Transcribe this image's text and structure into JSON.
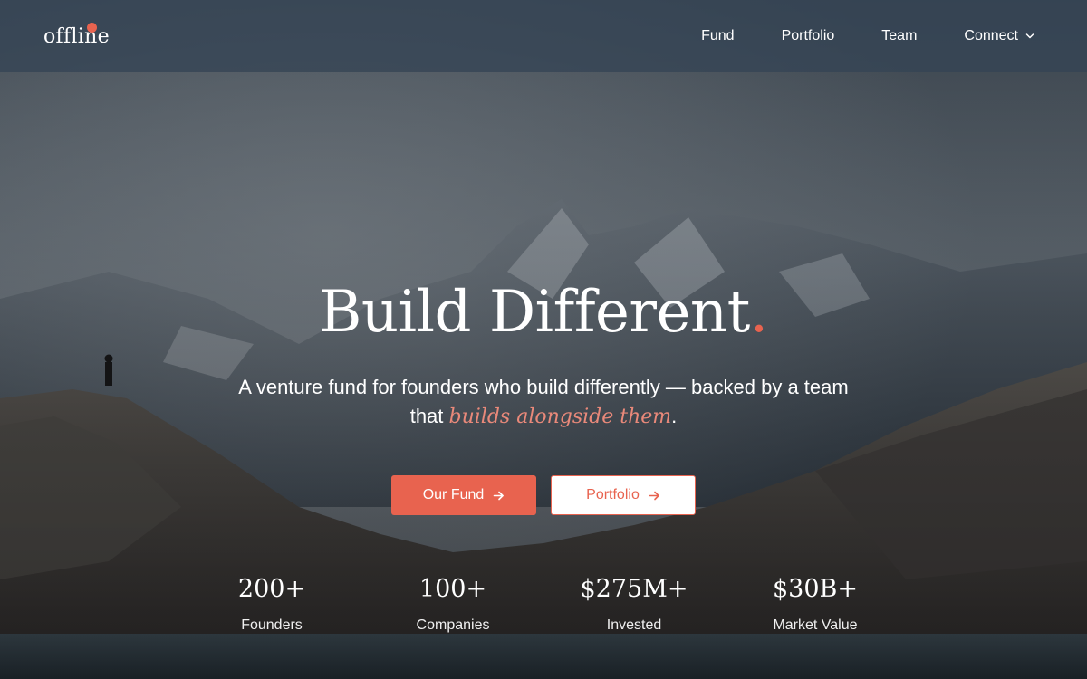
{
  "header": {
    "logo_text": "offline",
    "nav": [
      {
        "label": "Fund"
      },
      {
        "label": "Portfolio"
      },
      {
        "label": "Team"
      },
      {
        "label": "Connect",
        "icon": "chevron-down-icon"
      }
    ]
  },
  "hero": {
    "title": "Build Different",
    "title_dot": ".",
    "subtitle_line1": "A venture fund for founders who build differently — backed by a team",
    "subtitle_line2_prefix": "that ",
    "subtitle_highlight": "builds alongside them",
    "subtitle_suffix": "."
  },
  "buttons": {
    "primary_label": "Our Fund",
    "primary_icon": "arrow-right-icon",
    "secondary_label": "Portfolio",
    "secondary_icon": "arrow-right-icon"
  },
  "stats": [
    {
      "value": "200+",
      "label": "Founders"
    },
    {
      "value": "100+",
      "label": "Companies"
    },
    {
      "value": "$275M+",
      "label": "Invested"
    },
    {
      "value": "$30B+",
      "label": "Market Value"
    }
  ],
  "colors": {
    "accent": "#e8634f",
    "accent_soft": "#e9897a",
    "header_bg": "#344454"
  }
}
